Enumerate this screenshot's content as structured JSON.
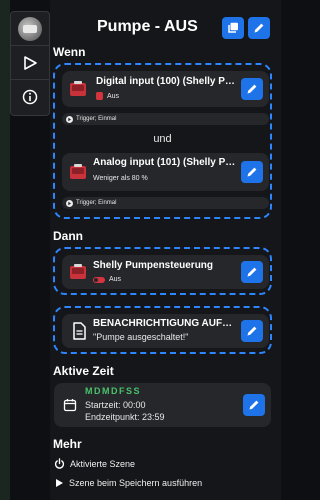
{
  "header": {
    "title": "Pumpe - AUS",
    "copy_icon": "copy-icon",
    "edit_icon": "pencil-icon"
  },
  "sidebar": {
    "items": [
      {
        "name": "avatar",
        "icon": "avatar"
      },
      {
        "name": "run",
        "icon": "play-triangle-icon"
      },
      {
        "name": "info",
        "icon": "info-icon"
      }
    ]
  },
  "wenn": {
    "title": "Wenn",
    "conditions": [
      {
        "title": "Digital input (100) (Shelly Pu...",
        "status": "Aus",
        "trigger": "Trigger; Einmal"
      },
      {
        "title": "Analog input (101) (Shelly Pum...",
        "status": "Weniger als 80 %",
        "trigger": "Trigger; Einmal"
      }
    ],
    "joiner": "und"
  },
  "dann": {
    "title": "Dann",
    "actions": [
      {
        "title": "Shelly Pumpensteuerung",
        "status": "Aus"
      },
      {
        "title": "BENACHRICHTIGUNG AUFS ...",
        "message": "\"Pumpe ausgeschaltet!\""
      }
    ]
  },
  "aktive_zeit": {
    "title": "Aktive Zeit",
    "days": "MDMDFSS",
    "start": "Startzeit: 00:00",
    "end": "Endzeitpunkt: 23:59"
  },
  "mehr": {
    "title": "Mehr",
    "items": [
      {
        "label": "Aktivierte Szene",
        "icon": "power-icon"
      },
      {
        "label": "Szene beim Speichern ausführen",
        "icon": "play-icon"
      }
    ]
  },
  "colors": {
    "accent": "#1e73e8",
    "dashed": "#2e86ff",
    "danger": "#d3353f",
    "days": "#49c26a"
  }
}
